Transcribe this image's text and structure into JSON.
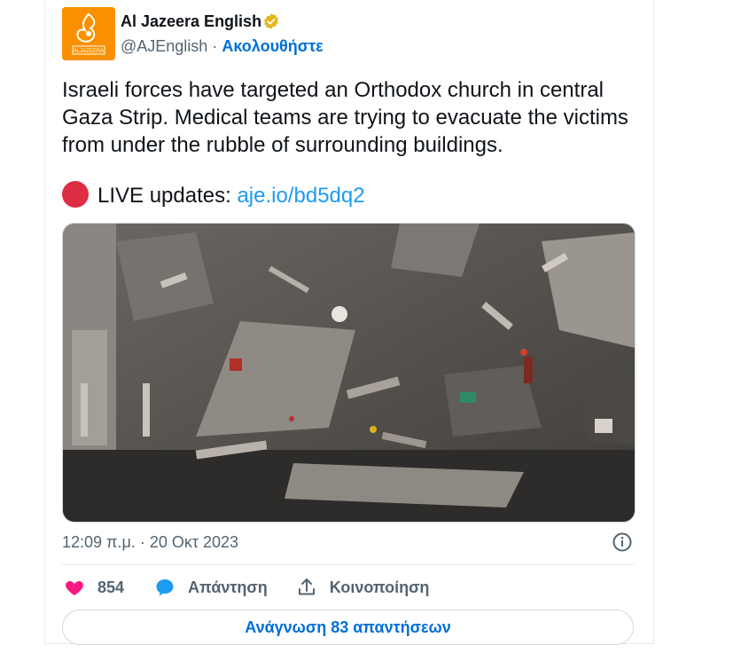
{
  "author": {
    "name": "Al Jazeera English",
    "handle": "@AJEnglish",
    "separator": "·",
    "follow_label": "Ακολουθήστε",
    "avatar_text": "ALJAZEERA",
    "verified": true,
    "icon": "verified-badge-icon"
  },
  "tweet": {
    "text": "Israeli forces have targeted an Orthodox church in central Gaza Strip. Medical teams are trying to evacuate the victims from under the rubble of surrounding buildings.",
    "live_prefix": "LIVE updates:",
    "live_link": "aje.io/bd5dq2",
    "timestamp": "12:09 π.μ. · 20 Οκτ 2023"
  },
  "actions": {
    "likes": "854",
    "reply_label": "Απάντηση",
    "share_label": "Κοινοποίηση"
  },
  "read_replies_label": "Ανάγνωση 83 απαντήσεων",
  "colors": {
    "brand_orange": "#fa9000",
    "link_blue": "#1d9bf0",
    "follow_blue": "#006fd6",
    "like_pink": "#f91880",
    "reply_blue": "#1d9bf0",
    "live_red": "#dd2e44",
    "verified_gold": "#e2b719"
  }
}
